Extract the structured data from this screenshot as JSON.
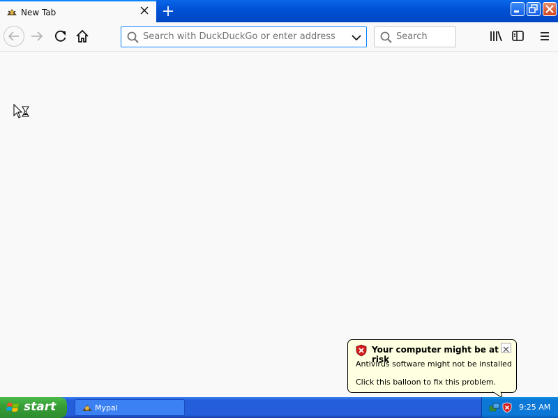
{
  "tab": {
    "title": "New Tab",
    "favicon": "mypal-icon",
    "close_icon": "close-icon"
  },
  "new_tab_icon": "plus-icon",
  "window_controls": {
    "minimize": "minimize-icon",
    "maximize": "restore-icon",
    "close": "close-icon"
  },
  "toolbar": {
    "back_icon": "back-arrow-icon",
    "forward_icon": "forward-arrow-icon",
    "reload_icon": "reload-icon",
    "home_icon": "home-icon",
    "url_placeholder": "Search with DuckDuckGo or enter address",
    "search_placeholder": "Search",
    "library_icon": "library-icon",
    "sidebar_icon": "sidebar-icon",
    "menu_icon": "hamburger-menu-icon"
  },
  "balloon": {
    "title": "Your computer might be at risk",
    "line1": "Antivirus software might not be installed",
    "line2": "Click this balloon to fix this problem.",
    "icon": "security-shield-icon"
  },
  "taskbar": {
    "start_label": "start",
    "tasks": [
      {
        "label": "Mypal",
        "icon": "mypal-icon"
      }
    ],
    "clock": "9:25 AM"
  },
  "colors": {
    "accent": "#0a84ff",
    "taskbar": "#245edb",
    "start": "#379f37",
    "balloon": "#ffffe1"
  }
}
